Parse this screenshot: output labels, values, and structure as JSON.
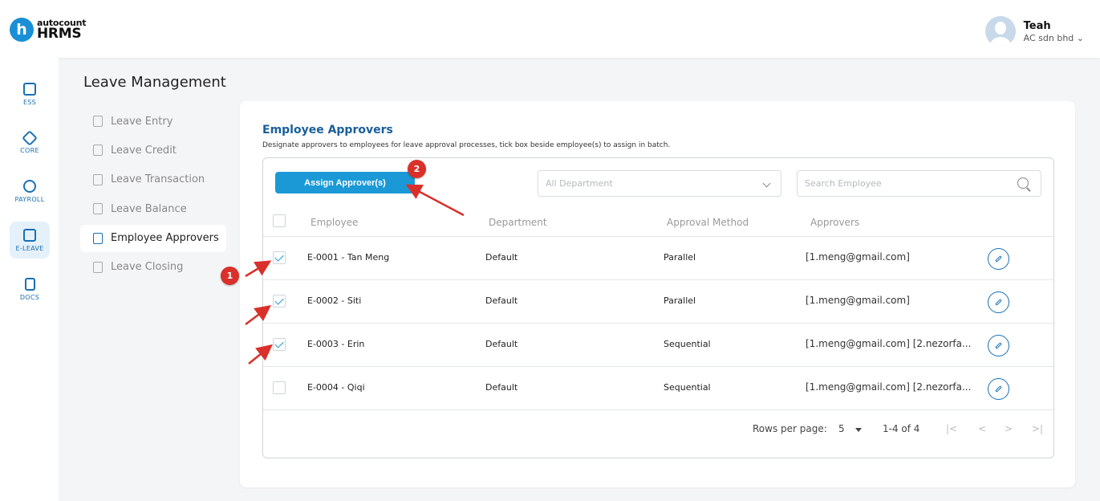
{
  "header": {
    "logo_mark": "h",
    "logo_top": "autocount",
    "logo_bottom": "HRMS",
    "user_name": "Teah",
    "user_org": "AC sdn bhd ⌄"
  },
  "rail": {
    "items": [
      {
        "label": "ESS",
        "icon": "id-card-icon"
      },
      {
        "label": "CORE",
        "icon": "cube-icon"
      },
      {
        "label": "PAYROLL",
        "icon": "dollar-icon"
      },
      {
        "label": "E-LEAVE",
        "icon": "calendar-icon"
      },
      {
        "label": "DOCS",
        "icon": "document-icon"
      }
    ]
  },
  "page_title": "Leave Management",
  "submenu": [
    {
      "label": "Leave Entry"
    },
    {
      "label": "Leave Credit"
    },
    {
      "label": "Leave Transaction"
    },
    {
      "label": "Leave Balance"
    },
    {
      "label": "Employee Approvers"
    },
    {
      "label": "Leave Closing"
    }
  ],
  "card": {
    "title": "Employee Approvers",
    "description": "Designate approvers to employees for leave approval processes, tick box beside employee(s) to assign in batch.",
    "assign_button": "Assign Approver(s)",
    "department_placeholder": "All Department",
    "search_placeholder": "Search Employee"
  },
  "table": {
    "headers": [
      "Employee",
      "Department",
      "Approval Method",
      "Approvers"
    ],
    "rows": [
      {
        "employee": "E-0001 - Tan Meng",
        "department": "Default",
        "method": "Parallel",
        "approvers": "[1.meng@gmail.com]",
        "checked": true
      },
      {
        "employee": "E-0002 - Siti",
        "department": "Default",
        "method": "Parallel",
        "approvers": "[1.meng@gmail.com]",
        "checked": true
      },
      {
        "employee": "E-0003 - Erin",
        "department": "Default",
        "method": "Sequential",
        "approvers": "[1.meng@gmail.com] [2.nezorfa...",
        "checked": true
      },
      {
        "employee": "E-0004 - Qiqi",
        "department": "Default",
        "method": "Sequential",
        "approvers": "[1.meng@gmail.com] [2.nezorfa...",
        "checked": false
      }
    ]
  },
  "pagination": {
    "rows_per_page_label": "Rows per page:",
    "rows_per_page": "5",
    "range": "1-4 of 4",
    "first": "|<",
    "prev": "<",
    "next": ">",
    "last": ">|"
  },
  "annotations": {
    "badge_1": "1",
    "badge_2": "2",
    "color": "#d9302a"
  }
}
